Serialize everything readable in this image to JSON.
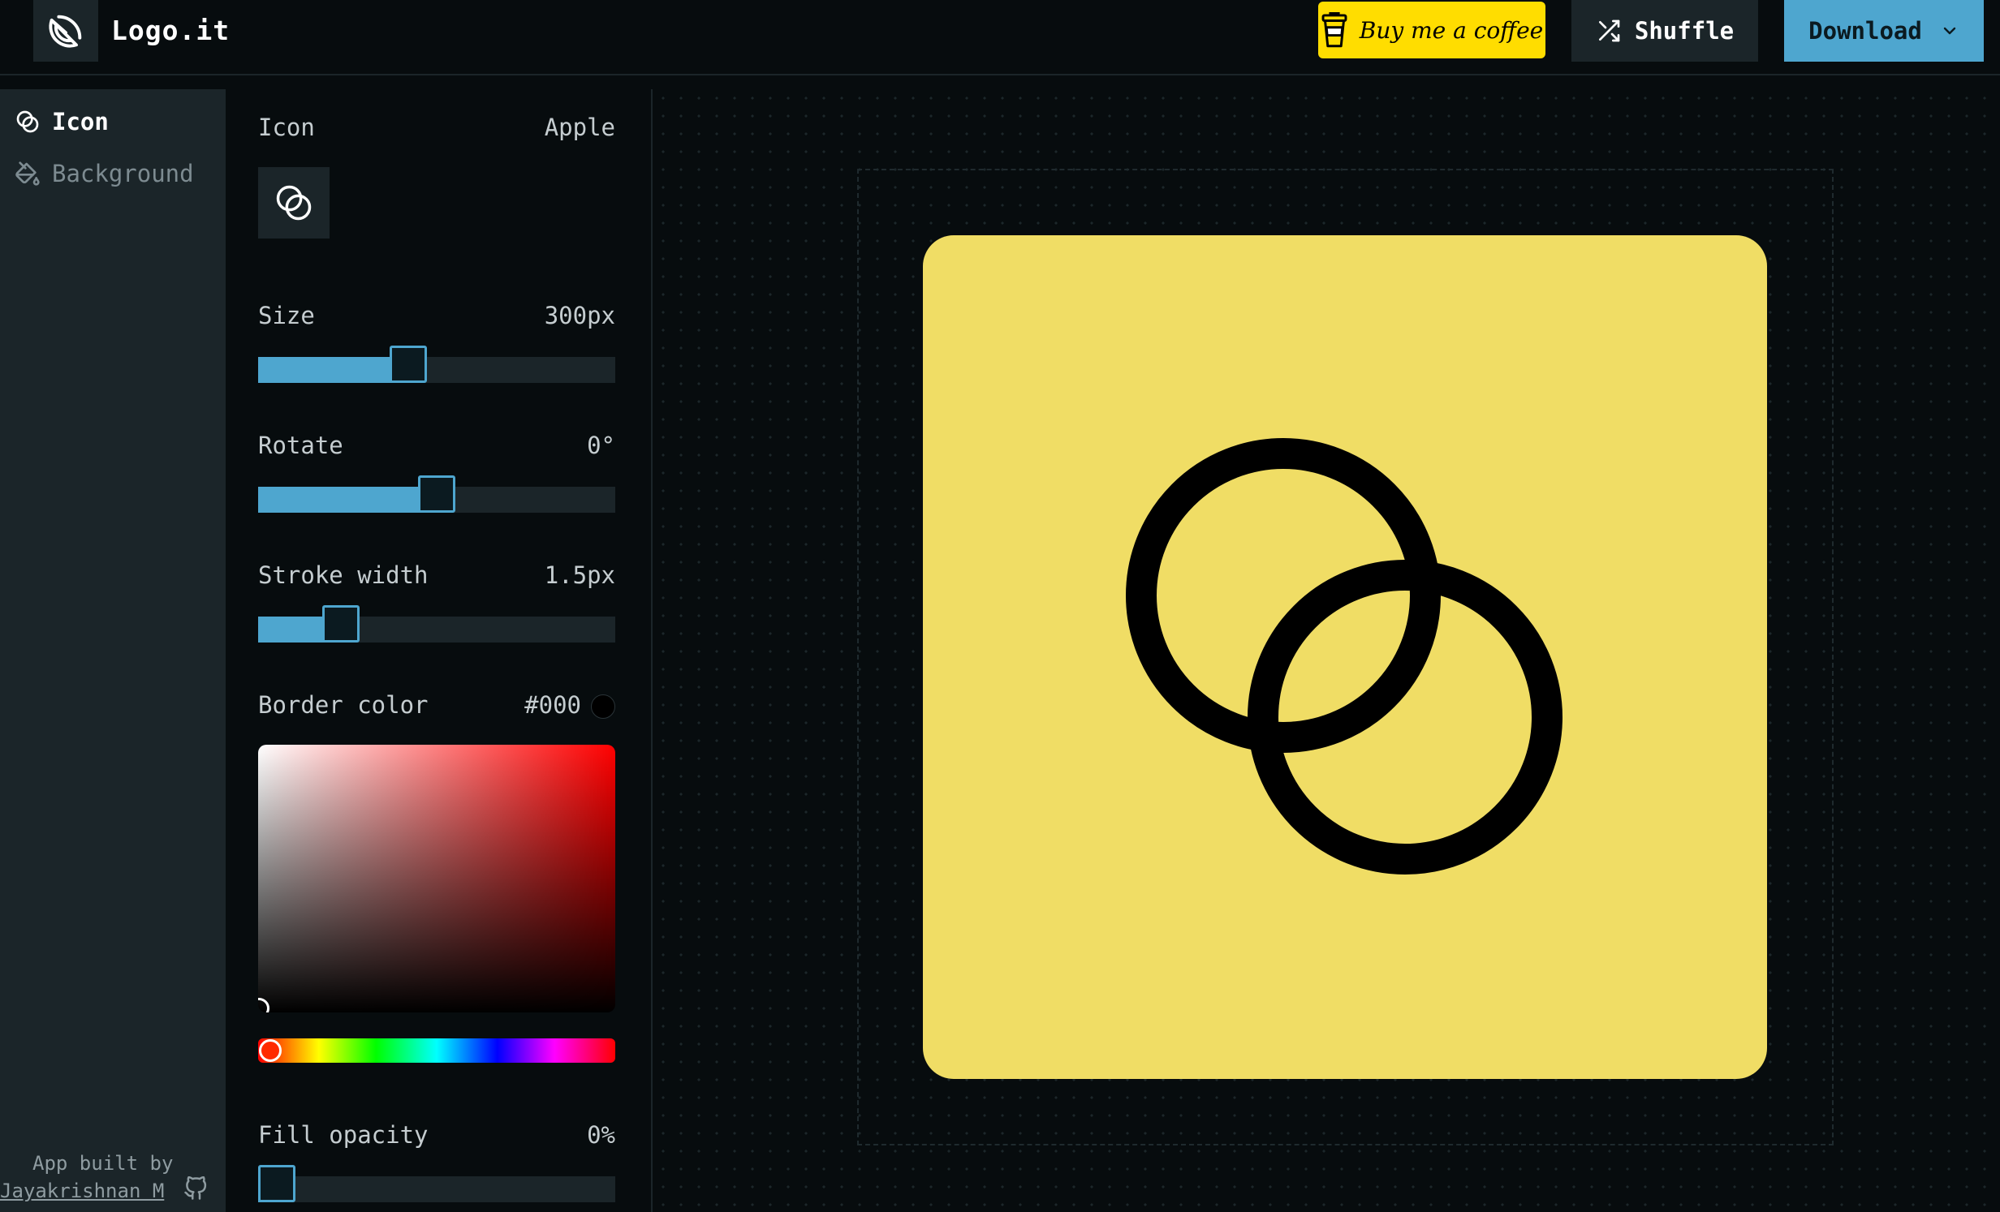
{
  "app": {
    "title": "Logo.it"
  },
  "header": {
    "coffee_label": "Buy me a coffee",
    "shuffle_label": "Shuffle",
    "download_label": "Download"
  },
  "nav": {
    "items": [
      {
        "label": "Icon",
        "icon": "intersecting-circles-icon",
        "active": true
      },
      {
        "label": "Background",
        "icon": "paint-bucket-icon",
        "active": false
      }
    ]
  },
  "credit": {
    "line1": "App built by",
    "author": "Jayakrishnan M"
  },
  "settings": {
    "icon": {
      "label": "Icon",
      "value": "Apple"
    },
    "size": {
      "label": "Size",
      "value": "300px",
      "position_fraction": 0.41
    },
    "rotate": {
      "label": "Rotate",
      "value": "0°",
      "position_fraction": 0.5
    },
    "stroke_width": {
      "label": "Stroke width",
      "value": "1.5px",
      "position_fraction": 0.2
    },
    "border_color": {
      "label": "Border color",
      "value": "#000"
    },
    "fill_opacity": {
      "label": "Fill opacity",
      "value": "0%",
      "position_fraction": 0.0
    }
  },
  "colors": {
    "accent": "#4ea6cf",
    "panel_bg": "#1b2529",
    "page_bg": "#070c0e",
    "coffee_yellow": "#ffdd00",
    "logo_background": "#f0dd65",
    "icon_stroke": "#000000"
  }
}
